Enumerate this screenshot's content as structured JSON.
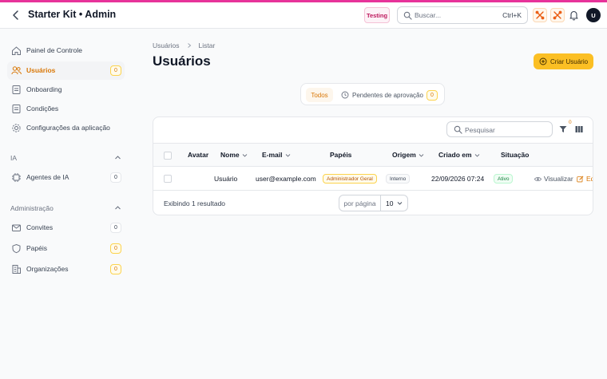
{
  "header": {
    "title": "Starter Kit • Admin",
    "env_badge": "Testing",
    "search_placeholder": "Buscar...",
    "search_shortcut": "Ctrl+K",
    "avatar_initial": "U"
  },
  "sidebar": {
    "items": [
      {
        "label": "Painel de Controle",
        "icon": "home-icon"
      },
      {
        "label": "Usuários",
        "icon": "users-icon",
        "count": "0",
        "active": true
      },
      {
        "label": "Onboarding",
        "icon": "document-icon"
      },
      {
        "label": "Condições",
        "icon": "document-icon"
      },
      {
        "label": "Configurações da aplicação",
        "icon": "gear-icon"
      }
    ],
    "groups": [
      {
        "label": "IA",
        "items": [
          {
            "label": "Agentes de IA",
            "icon": "cpu-icon",
            "count": "0"
          }
        ]
      },
      {
        "label": "Administração",
        "items": [
          {
            "label": "Convites",
            "icon": "envelope-icon",
            "count": "0"
          },
          {
            "label": "Papéis",
            "icon": "shield-icon",
            "count": "0"
          },
          {
            "label": "Organizações",
            "icon": "building-icon",
            "count": "0"
          }
        ]
      }
    ]
  },
  "main": {
    "breadcrumb": [
      "Usuários",
      "Listar"
    ],
    "title": "Usuários",
    "create_button": "Criar Usuário",
    "tabs": [
      {
        "label": "Todos",
        "active": true
      },
      {
        "label": "Pendentes de aprovação",
        "count": "0"
      }
    ],
    "table": {
      "search_placeholder": "Pesquisar",
      "filter_count": "0",
      "columns": [
        "Avatar",
        "Nome",
        "E-mail",
        "Papéis",
        "Origem",
        "Criado em",
        "Situação"
      ],
      "rows": [
        {
          "name": "Usuário",
          "email": "user@example.com",
          "role": "Administrador Geral",
          "origin": "Interno",
          "created_at": "22/09/2026 07:24",
          "status": "Ativo",
          "action_view": "Visualizar",
          "action_edit": "Edi"
        }
      ],
      "footer_text": "Exibindo 1 resultado",
      "per_page_label": "por página",
      "per_page_value": "10"
    }
  },
  "colors": {
    "accent": "#e7339a",
    "primary": "#fbbf24",
    "primary_text": "#d97706"
  }
}
